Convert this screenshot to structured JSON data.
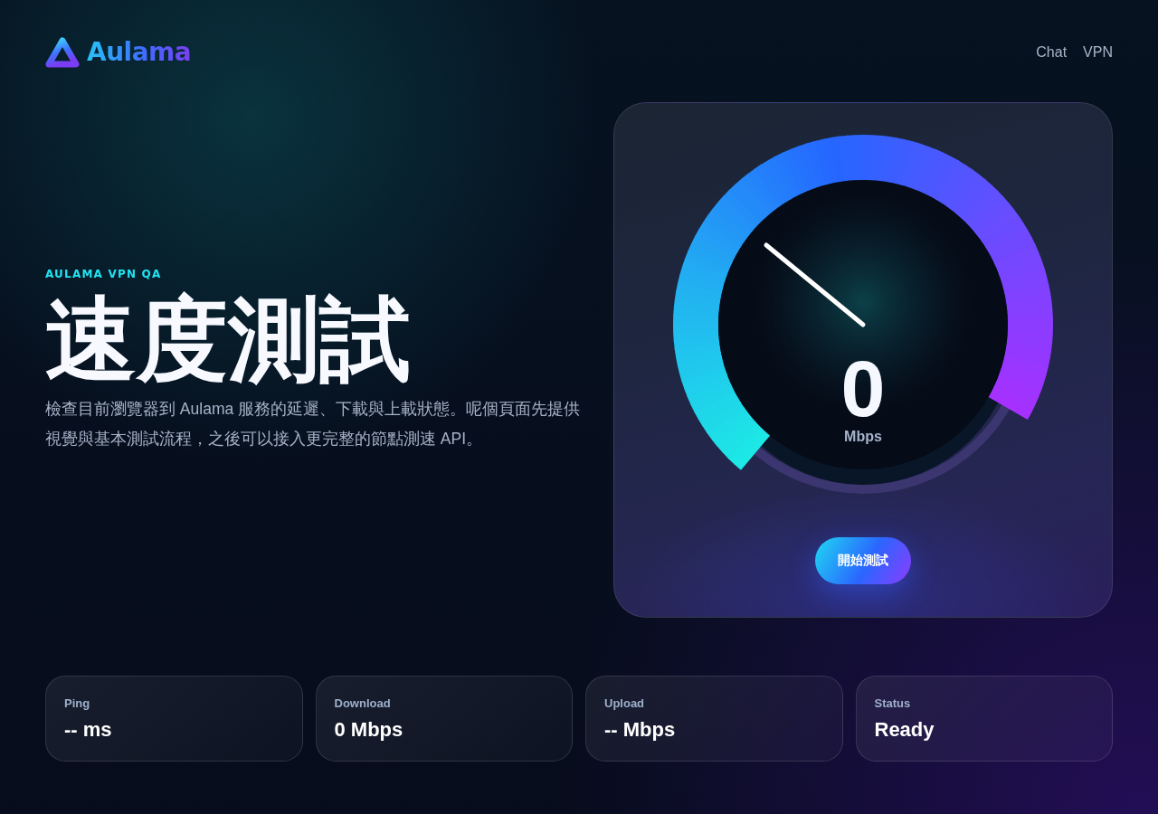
{
  "header": {
    "logo": {
      "text": "Aulama"
    },
    "nav": [
      {
        "label": "Chat"
      },
      {
        "label": "VPN"
      }
    ]
  },
  "hero": {
    "eyebrow": "AULAMA VPN QA",
    "title": "速度測試",
    "description": "檢查目前瀏覽器到 Aulama 服務的延遲、下載與上載狀態。呢個頁面先提供視覺與基本測試流程，之後可以接入更完整的節點測速 API。"
  },
  "speed_test": {
    "reading": "0",
    "unit": "Mbps",
    "button": "開始測試"
  },
  "stats": [
    {
      "label": "Ping",
      "value": "-- ms"
    },
    {
      "label": "Download",
      "value": "0 Mbps"
    },
    {
      "label": "Upload",
      "value": "-- Mbps"
    },
    {
      "label": "Status",
      "value": "Ready"
    }
  ]
}
